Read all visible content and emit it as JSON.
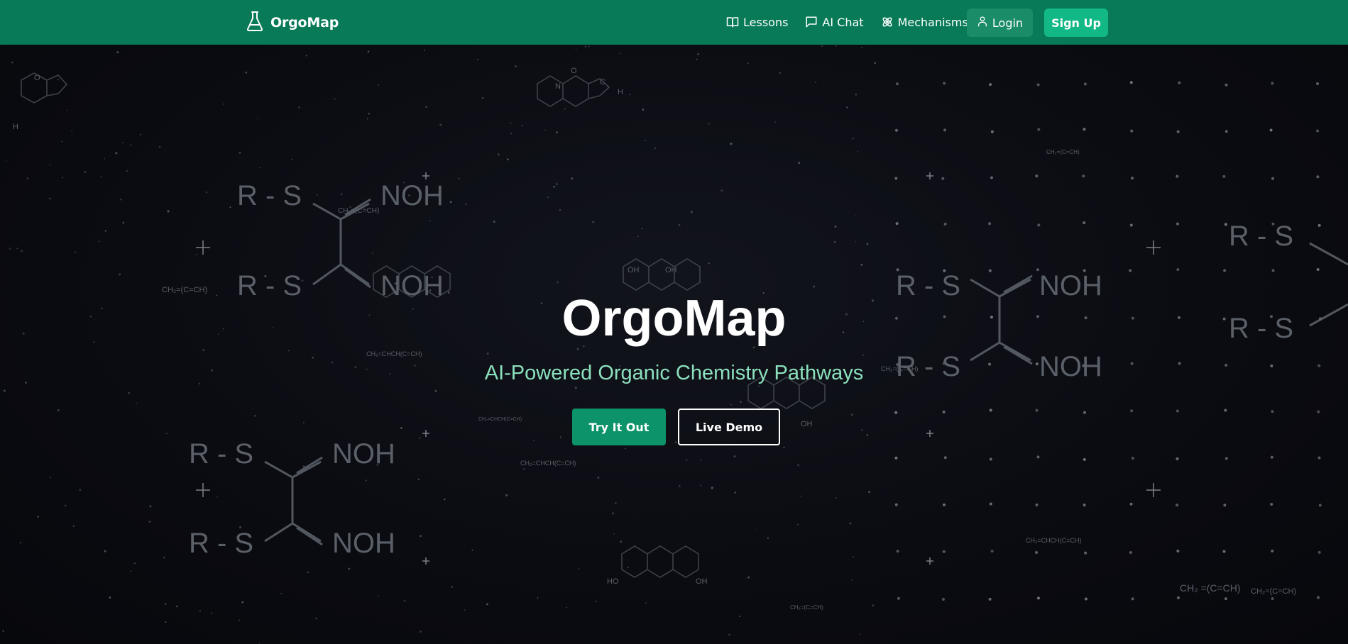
{
  "navbar": {
    "brand": "OrgoMap",
    "brand_icon": "flask-icon",
    "links": [
      {
        "label": "Lessons",
        "icon": "book-icon"
      },
      {
        "label": "AI Chat",
        "icon": "chat-icon"
      },
      {
        "label": "Mechanisms",
        "icon": "atom-icon"
      }
    ],
    "login_label": "Login",
    "login_icon": "user-icon",
    "signup_label": "Sign Up"
  },
  "hero": {
    "title": "OrgoMap",
    "subtitle": "AI-Powered Organic Chemistry Pathways",
    "primary_button": "Try It Out",
    "secondary_button": "Live Demo"
  },
  "background": {
    "formula_labels": [
      "R - S",
      "NOH",
      "CH₂=(C=CH)",
      "CH₂=CHCH(C=CH)",
      "CH₂ =(C=CH)"
    ],
    "atom_labels": [
      "O",
      "N",
      "H",
      "C",
      "OH",
      "HO"
    ]
  },
  "colors": {
    "navbar": "#087a57",
    "primary_button": "#0d936a",
    "signup_button": "#12b885",
    "subtitle": "#8be0bd",
    "background": "#0a0b10"
  }
}
